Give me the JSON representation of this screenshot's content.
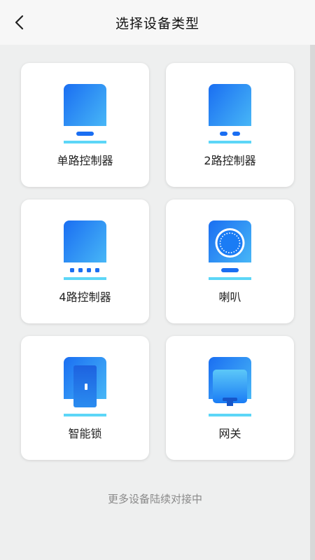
{
  "header": {
    "title": "选择设备类型"
  },
  "devices": [
    {
      "label": "单路控制器",
      "icon": "single-controller-icon"
    },
    {
      "label": "2路控制器",
      "icon": "two-way-controller-icon"
    },
    {
      "label": "4路控制器",
      "icon": "four-way-controller-icon"
    },
    {
      "label": "喇叭",
      "icon": "speaker-icon"
    },
    {
      "label": "智能锁",
      "icon": "smart-lock-icon"
    },
    {
      "label": "网关",
      "icon": "gateway-icon"
    }
  ],
  "footer": {
    "text": "更多设备陆续对接中"
  },
  "colors": {
    "accent": "#1a7cf5",
    "accent_light": "#5cd6f7",
    "background": "#eeefef"
  }
}
